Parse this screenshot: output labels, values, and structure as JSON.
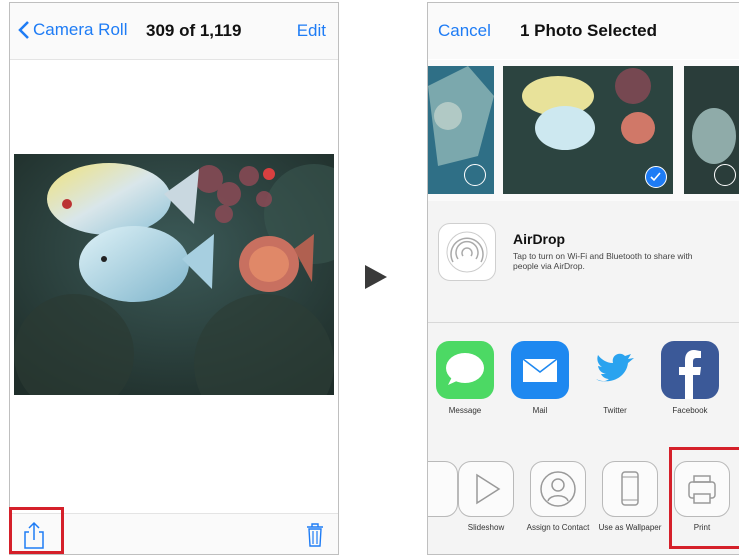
{
  "left": {
    "back_label": "Camera Roll",
    "photo_count": "309 of 1,119",
    "edit_label": "Edit"
  },
  "right": {
    "cancel_label": "Cancel",
    "title": "1 Photo Selected",
    "airdrop": {
      "title": "AirDrop",
      "description": "Tap to turn on Wi-Fi and Bluetooth to share with people via AirDrop."
    },
    "share_apps": [
      {
        "label": "Message",
        "icon": "message-icon",
        "color": "#4cd964"
      },
      {
        "label": "Mail",
        "icon": "mail-icon",
        "color": "#1e88f0"
      },
      {
        "label": "Twitter",
        "icon": "twitter-icon",
        "color": "#2aa3ef"
      },
      {
        "label": "Facebook",
        "icon": "facebook-icon",
        "color": "#3b5998"
      }
    ],
    "actions": [
      {
        "label": "Slideshow",
        "icon": "play-icon"
      },
      {
        "label": "Assign to Contact",
        "icon": "contact-icon"
      },
      {
        "label": "Use as Wallpaper",
        "icon": "phone-icon"
      },
      {
        "label": "Print",
        "icon": "printer-icon"
      }
    ]
  },
  "colors": {
    "accent": "#1e7cf5",
    "highlight": "#d5202a"
  }
}
